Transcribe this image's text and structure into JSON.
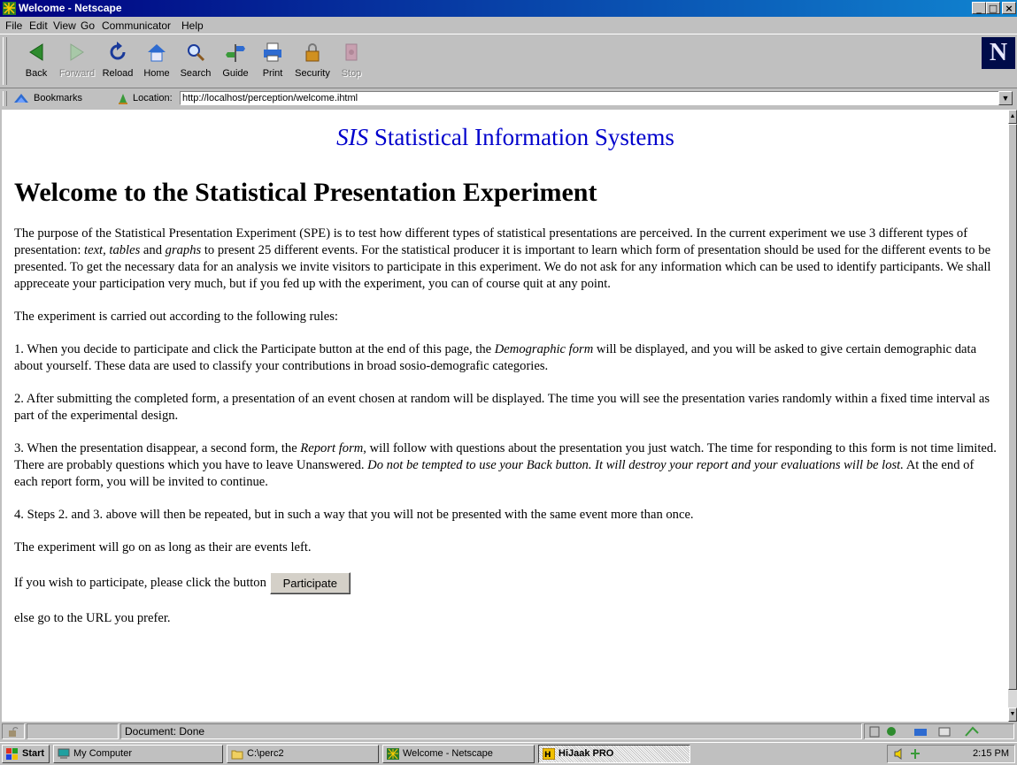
{
  "window": {
    "title": "Welcome - Netscape",
    "minimize": "_",
    "maximize": "□",
    "close": "×"
  },
  "menu": [
    "File",
    "Edit",
    "View",
    "Go",
    "Communicator",
    "Help"
  ],
  "toolbar": {
    "back": "Back",
    "forward": "Forward",
    "reload": "Reload",
    "home": "Home",
    "search": "Search",
    "guide": "Guide",
    "print": "Print",
    "security": "Security",
    "stop": "Stop",
    "logo": "N"
  },
  "location": {
    "bookmarks": "Bookmarks",
    "label": "Location:",
    "url": "http://localhost/perception/welcome.ihtml"
  },
  "page": {
    "brand_italic": "SIS",
    "brand_rest": "Statistical Information Systems",
    "heading": "Welcome to the Statistical Presentation Experiment",
    "intro_1": "The purpose of the Statistical Presentation Experiment (SPE) is to test how different types of statistical presentations are perceived. In the current experiment we use 3 different types of presentation: ",
    "intro_text": "text",
    "intro_sep1": ", ",
    "intro_tables": "tables",
    "intro_and": " and ",
    "intro_graphs": "graphs",
    "intro_2": " to present 25 different events. For the statistical producer it is important to learn which form of presentation should be used for the different events to be presented. To get the necessary data for an analysis we invite visitors to participate in this experiment. We do not ask for any information which can be used to identify participants. We shall appreceate your participation very much, but if you fed up with the experiment, you can of course quit at any point.",
    "rules_intro": "The experiment is carried out according to the following rules:",
    "rule1_a": "1. When you decide to participate and click the Participate button at the end of this page, the ",
    "rule1_em": "Demographic form",
    "rule1_b": " will be displayed, and you will be asked to give certain demographic data about yourself. These data are used to classify your contributions in broad sosio-demografic categories.",
    "rule2": "2. After submitting the completed form, a presentation of an event chosen at random will be displayed. The time you will see the presentation varies randomly within a fixed time interval as part of the experimental design.",
    "rule3_a": "3. When the presentation disappear, a second form, the ",
    "rule3_em": "Report form",
    "rule3_b": ", will follow with questions about the presentation you just watch. The time for responding to this form is not time limited. There are probably questions which you have to leave Unanswered. ",
    "rule3_em2": "Do not be tempted to use your Back button. It will destroy your report and your evaluations will be lost.",
    "rule3_c": " At the end of each report form, you will be invited to continue.",
    "rule4": "4. Steps 2. and 3. above will then be repeated, but in such a way that you will not be presented with the same event more than once.",
    "goon": "The experiment will go on as long as their are events left.",
    "participate_prompt": "If you wish to participate, please click the button",
    "participate_button": "Participate",
    "else": "else go to the URL you prefer."
  },
  "status": {
    "text": "Document: Done"
  },
  "taskbar": {
    "start": "Start",
    "tasks": [
      "My Computer",
      "C:\\perc2",
      "Welcome - Netscape",
      "HiJaak PRO"
    ],
    "clock": "2:15 PM"
  }
}
